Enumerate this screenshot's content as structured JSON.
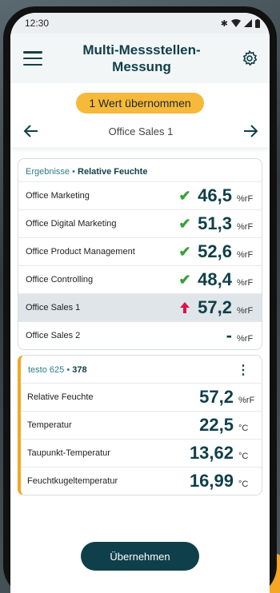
{
  "status": {
    "time": "12:30",
    "icons": [
      "bluetooth-icon",
      "wifi-icon",
      "signal-icon",
      "battery-icon"
    ]
  },
  "appbar": {
    "title_line1": "Multi-Messstellen-",
    "title_line2": "Messung"
  },
  "toast": {
    "text": "1 Wert übernommen"
  },
  "nav": {
    "current": "Office Sales 1"
  },
  "results": {
    "header_prefix": "Ergebnisse",
    "header_sep": " • ",
    "header_title": "Relative Feuchte",
    "rows": [
      {
        "label": "Office Marketing",
        "status": "check",
        "value": "46,5",
        "unit": "%rF"
      },
      {
        "label": "Office Digital Marketing",
        "status": "check",
        "value": "51,3",
        "unit": "%rF"
      },
      {
        "label": "Office Product Management",
        "status": "check",
        "value": "52,6",
        "unit": "%rF"
      },
      {
        "label": "Office Controlling",
        "status": "check",
        "value": "48,4",
        "unit": "%rF"
      },
      {
        "label": "Office Sales 1",
        "status": "up",
        "value": "57,2",
        "unit": "%rF"
      },
      {
        "label": "Office Sales 2",
        "status": "none",
        "value": "-",
        "unit": "%rF"
      }
    ]
  },
  "device": {
    "name": "testo 625",
    "sep": " • ",
    "serial": "378",
    "rows": [
      {
        "label": "Relative Feuchte",
        "value": "57,2",
        "unit": "%rF"
      },
      {
        "label": "Temperatur",
        "value": "22,5",
        "unit": "°C"
      },
      {
        "label": "Taupunkt-Temperatur",
        "value": "13,62",
        "unit": "°C"
      },
      {
        "label": "Feuchtkugeltemperatur",
        "value": "16,99",
        "unit": "°C"
      }
    ]
  },
  "actions": {
    "primary_label": "Übernehmen"
  },
  "colors": {
    "primary": "#0f3f4a",
    "accent": "#f5a623",
    "ok": "#3aa03a",
    "alert": "#e0104a"
  }
}
